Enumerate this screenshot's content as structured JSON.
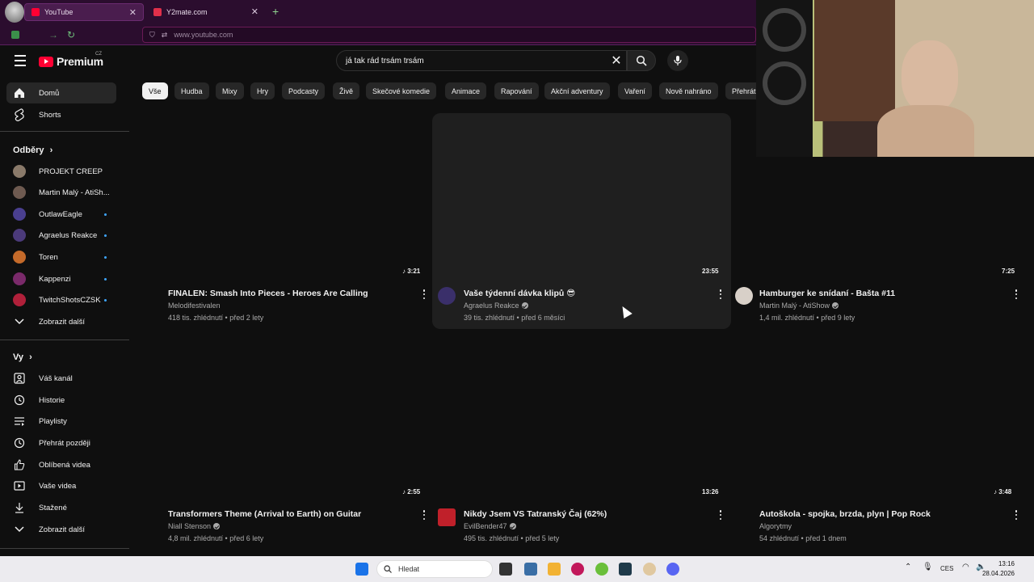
{
  "browser": {
    "tabs": [
      {
        "label": "YouTube",
        "active": true
      },
      {
        "label": "Y2mate.com",
        "active": false
      }
    ],
    "url": "www.youtube.com"
  },
  "header": {
    "logo": "Premium",
    "region": "CZ",
    "search_value": "já tak rád trsám trsám"
  },
  "sidebar": {
    "main": [
      {
        "label": "Domů",
        "icon": "home-icon"
      },
      {
        "label": "Shorts",
        "icon": "shorts-icon"
      }
    ],
    "subs_heading": "Odběry",
    "subs": [
      {
        "label": "PROJEKT CREEP",
        "color": "#8a7a6a",
        "dot": false
      },
      {
        "label": "Martin Malý - AtiSh...",
        "color": "#6e5a50",
        "dot": false
      },
      {
        "label": "OutlawEagle",
        "color": "#4a3f8f",
        "dot": true
      },
      {
        "label": "Agraelus Reakce",
        "color": "#4b3a7a",
        "dot": true
      },
      {
        "label": "Toren",
        "color": "#c46a2a",
        "dot": true
      },
      {
        "label": "Kappenzi",
        "color": "#7a2a6a",
        "dot": true
      },
      {
        "label": "TwitchShotsCZSK",
        "color": "#b0203a",
        "dot": true
      }
    ],
    "subs_more": "Zobrazit další",
    "you_heading": "Vy",
    "you": [
      {
        "label": "Váš kanál",
        "icon": "channel-icon"
      },
      {
        "label": "Historie",
        "icon": "history-icon"
      },
      {
        "label": "Playlisty",
        "icon": "playlist-icon"
      },
      {
        "label": "Přehrát později",
        "icon": "watch-later-icon"
      },
      {
        "label": "Oblíbená videa",
        "icon": "like-icon"
      },
      {
        "label": "Vaše videa",
        "icon": "your-videos-icon"
      },
      {
        "label": "Stažené",
        "icon": "download-icon"
      },
      {
        "label": "Zobrazit další",
        "icon": "chevron-down-icon"
      }
    ]
  },
  "chips": [
    "Vše",
    "Hudba",
    "Mixy",
    "Hry",
    "Podcasty",
    "Živě",
    "Skečové komedie",
    "Animace",
    "Rapování",
    "Akční adventury",
    "Vaření",
    "Nově nahráno",
    "Přehrát"
  ],
  "videos": [
    {
      "title": "FINALEN: Smash Into Pieces - Heroes Are Calling",
      "channel": "Melodifestivalen",
      "verified": false,
      "meta": "418 tis. zhlédnutí • před 2 lety",
      "duration": "3:21",
      "music": true,
      "avatar": false
    },
    {
      "title": "Vaše týdenní dávka klipů 😎",
      "channel": "Agraelus Reakce",
      "verified": true,
      "meta": "39 tis. zhlédnutí • před 6 měsíci",
      "duration": "23:55",
      "music": false,
      "avatar": true,
      "avatar_color": "#3a2f6a"
    },
    {
      "title": "Hamburger ke snídaní - Bašta #11",
      "channel": "Martin Malý - AtiShow",
      "verified": true,
      "meta": "1,4 mil. zhlédnutí • před 9 lety",
      "duration": "7:25",
      "music": false,
      "avatar": true,
      "avatar_color": "#d8d0c8"
    },
    {
      "title": "Transformers Theme (Arrival to Earth) on Guitar",
      "channel": "Niall Stenson",
      "verified": true,
      "meta": "4,8 mil. zhlédnutí • před 6 lety",
      "duration": "2:55",
      "music": true,
      "avatar": false
    },
    {
      "title": "Nikdy Jsem VS Tatranský Čaj (62%)",
      "channel": "EvilBender47",
      "verified": true,
      "meta": "495 tis. zhlédnutí • před 5 lety",
      "duration": "13:26",
      "music": false,
      "avatar": true,
      "avatar_color": "#c0202a"
    },
    {
      "title": "Autoškola - spojka, brzda, plyn | Pop Rock",
      "channel": "Algorytmy",
      "verified": false,
      "meta": "54 zhlédnutí • před 1 dnem",
      "duration": "3:48",
      "music": true,
      "avatar": false
    }
  ],
  "taskbar": {
    "search_placeholder": "Hledat",
    "lang": "CES",
    "time": "13:16",
    "date": "28.04.2026"
  },
  "colors": {
    "accent": "#ff0033",
    "bg": "#0f0f0f",
    "chrome": "#2b0d2e",
    "link": "#3ea6ff"
  }
}
